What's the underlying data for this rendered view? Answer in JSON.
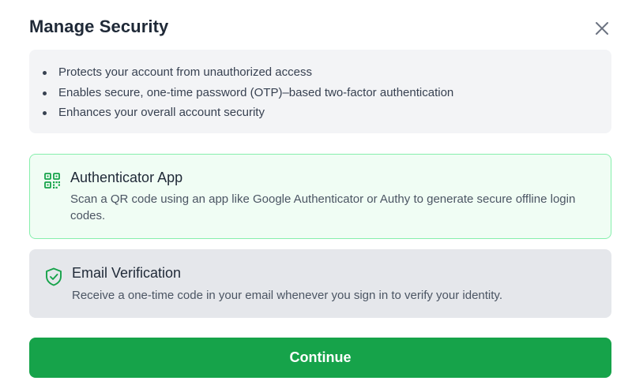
{
  "dialog": {
    "title": "Manage Security",
    "close_icon": "close-icon"
  },
  "benefits": {
    "items": [
      "Protects your account from unauthorized access",
      "Enables secure, one-time password (OTP)–based two-factor authentication",
      "Enhances your overall account security"
    ]
  },
  "options": [
    {
      "icon": "qr-code-icon",
      "title": "Authenticator App",
      "description": "Scan a QR code using an app like Google Authenticator or Authy to generate secure offline login codes.",
      "selected": true
    },
    {
      "icon": "shield-check-icon",
      "title": "Email Verification",
      "description": "Receive a one-time code in your email whenever you sign in to verify your identity.",
      "selected": false
    }
  ],
  "actions": {
    "continue_label": "Continue"
  },
  "colors": {
    "accent": "#16a34a",
    "selected_bg": "#f0fdf4",
    "selected_border": "#86efac",
    "unselected_bg": "#e5e7eb",
    "benefits_bg": "#f3f4f6"
  }
}
